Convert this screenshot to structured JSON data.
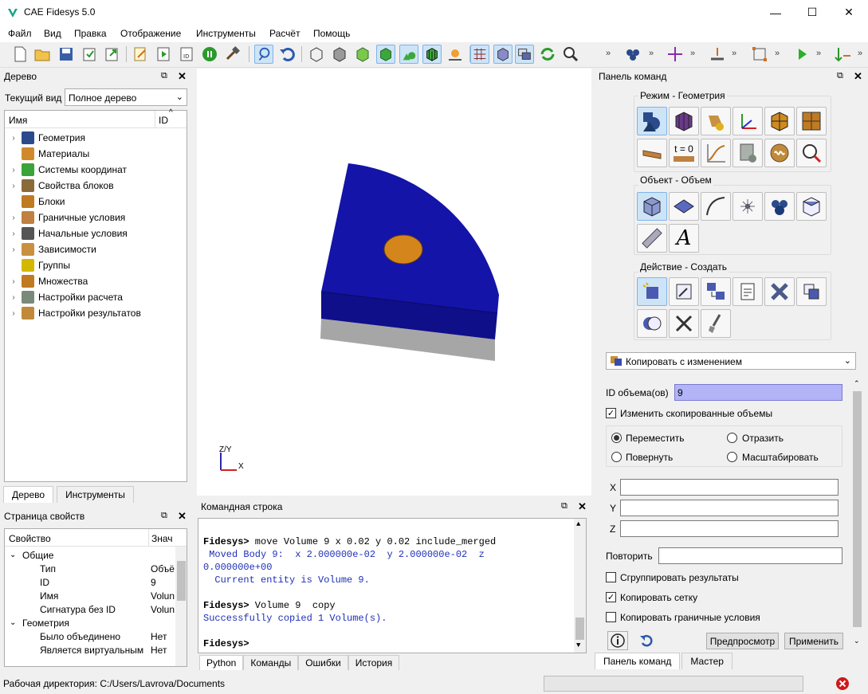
{
  "window": {
    "title": "CAE Fidesys 5.0",
    "minimize": "—",
    "maximize": "☐",
    "close": "✕"
  },
  "menu": [
    "Файл",
    "Вид",
    "Правка",
    "Отображение",
    "Инструменты",
    "Расчёт",
    "Помощь"
  ],
  "tree_panel": {
    "title": "Дерево",
    "view_label": "Текущий вид",
    "view_value": "Полное дерево",
    "col_name": "Имя",
    "col_id": "ID",
    "items": [
      {
        "label": "Геометрия",
        "icon": "geometry-icon",
        "color": "#2b4a8c"
      },
      {
        "label": "Материалы",
        "icon": "materials-icon",
        "color": "#d08a2c"
      },
      {
        "label": "Системы координат",
        "icon": "axes-icon",
        "color": "#3aa33a"
      },
      {
        "label": "Свойства блоков",
        "icon": "beam-icon",
        "color": "#8b6a3a"
      },
      {
        "label": "Блоки",
        "icon": "blocks-icon",
        "color": "#c07a20"
      },
      {
        "label": "Граничные условия",
        "icon": "boundary-icon",
        "color": "#c08040"
      },
      {
        "label": "Начальные условия",
        "icon": "t0-icon",
        "color": "#555555"
      },
      {
        "label": "Зависимости",
        "icon": "graph-icon",
        "color": "#c89040"
      },
      {
        "label": "Группы",
        "icon": "groups-icon",
        "color": "#d4b800"
      },
      {
        "label": "Множества",
        "icon": "sets-icon",
        "color": "#c07a20"
      },
      {
        "label": "Настройки расчета",
        "icon": "calc-settings-icon",
        "color": "#7a8a7a"
      },
      {
        "label": "Настройки результатов",
        "icon": "results-icon",
        "color": "#c08a3a"
      }
    ],
    "tabs": [
      "Дерево",
      "Инструменты"
    ]
  },
  "props_panel": {
    "title": "Страница свойств",
    "col_prop": "Свойство",
    "col_val": "Знач",
    "rows": [
      {
        "name": "Общие",
        "value": "",
        "group": true
      },
      {
        "name": "Тип",
        "value": "Объё"
      },
      {
        "name": "ID",
        "value": "9"
      },
      {
        "name": "Имя",
        "value": "Volun"
      },
      {
        "name": "Сигнатура без ID",
        "value": "Volun"
      },
      {
        "name": "Геометрия",
        "value": "",
        "group": true
      },
      {
        "name": "Было объединено",
        "value": "Нет"
      },
      {
        "name": "Является виртуальным",
        "value": "Нет"
      }
    ]
  },
  "viewport": {
    "axis_y": "Z/Y",
    "axis_x": "X"
  },
  "console": {
    "title": "Командная строка",
    "lines": [
      {
        "text": "Fidesys> move Volume 9 x 0.02 y 0.02 include_merged",
        "kind": "prompt"
      },
      {
        "text": " Moved Body 9:  x 2.000000e-02  y 2.000000e-02  z",
        "kind": "out"
      },
      {
        "text": "0.000000e+00",
        "kind": "out"
      },
      {
        "text": "  Current entity is Volume 9.",
        "kind": "out"
      },
      {
        "text": "",
        "kind": "out"
      },
      {
        "text": "Fidesys> Volume 9  copy",
        "kind": "prompt"
      },
      {
        "text": "Successfully copied 1 Volume(s).",
        "kind": "out"
      },
      {
        "text": "",
        "kind": "out"
      },
      {
        "text": "Fidesys>",
        "kind": "prompt"
      }
    ],
    "tabs": [
      "Python",
      "Команды",
      "Ошибки",
      "История"
    ]
  },
  "cmd_panel": {
    "title": "Панель команд",
    "mode_label": "Режим - Геометрия",
    "object_label": "Объект - Объем",
    "action_label": "Действие - Создать",
    "t0_label": "t = 0",
    "italic_a": "A",
    "operation": "Копировать с изменением",
    "id_label": "ID объема(ов)",
    "id_value": "9",
    "modify_label": "Изменить скопированные объемы",
    "radio": {
      "move": "Переместить",
      "reflect": "Отразить",
      "rotate": "Повернуть",
      "scale": "Масштабировать"
    },
    "x_label": "X",
    "y_label": "Y",
    "z_label": "Z",
    "repeat_label": "Повторить",
    "group_label": "Сгруппировать результаты",
    "copy_mesh_label": "Копировать сетку",
    "copy_bc_label": "Копировать граничные условия",
    "preview_btn": "Предпросмотр",
    "apply_btn": "Применить",
    "tabs": [
      "Панель команд",
      "Мастер"
    ]
  },
  "status": {
    "workdir": "Рабочая директория: C:/Users/Lavrova/Documents"
  },
  "colors": {
    "body_blue": "#1414a8",
    "body_blue_side": "#0f0f8a",
    "plate_gray": "#a6a6a6",
    "hole_orange": "#d4861c",
    "select_blue": "#cde4f7"
  }
}
